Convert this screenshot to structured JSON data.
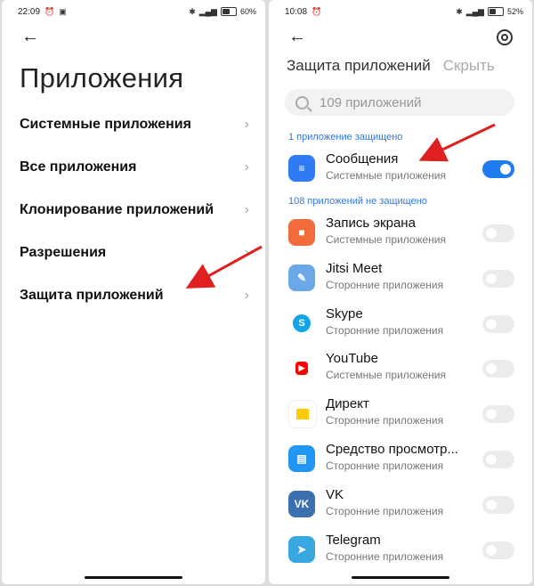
{
  "left_screen": {
    "status": {
      "time": "22:09",
      "battery": "60",
      "battery_level": 0.6
    },
    "title": "Приложения",
    "menu": [
      {
        "label": "Системные приложения"
      },
      {
        "label": "Все приложения"
      },
      {
        "label": "Клонирование приложений"
      },
      {
        "label": "Разрешения"
      },
      {
        "label": "Защита приложений"
      }
    ]
  },
  "right_screen": {
    "status": {
      "time": "10:08",
      "battery": "52",
      "battery_level": 0.52
    },
    "tabs": {
      "active": "Защита приложений",
      "inactive": "Скрыть"
    },
    "search": {
      "placeholder": "109 приложений"
    },
    "section_protected": "1 приложение защищено",
    "section_unprotected": "108 приложений не защищено",
    "protected_apps": [
      {
        "name": "Сообщения",
        "sub": "Системные приложения",
        "enabled": true,
        "icon": "messages-icon",
        "color": "#2f7bf3"
      }
    ],
    "apps": [
      {
        "name": "Запись экрана",
        "sub": "Системные приложения",
        "enabled": false,
        "icon": "screen-recorder-icon",
        "color": "#f26b3a"
      },
      {
        "name": "Jitsi Meet",
        "sub": "Сторонние приложения",
        "enabled": false,
        "icon": "jitsi-meet-icon",
        "color": "#6aa8e8"
      },
      {
        "name": "Skype",
        "sub": "Сторонние приложения",
        "enabled": false,
        "icon": "skype-icon",
        "color": "#12a3e8"
      },
      {
        "name": "YouTube",
        "sub": "Системные приложения",
        "enabled": false,
        "icon": "youtube-icon",
        "color": "#ff0000"
      },
      {
        "name": "Директ",
        "sub": "Сторонние приложения",
        "enabled": false,
        "icon": "direct-icon",
        "color": "#ffcc00"
      },
      {
        "name": "Средство просмотр...",
        "sub": "Сторонние приложения",
        "enabled": false,
        "icon": "document-viewer-icon",
        "color": "#2196f3"
      },
      {
        "name": "VK",
        "sub": "Сторонние приложения",
        "enabled": false,
        "icon": "vk-icon",
        "color": "#3a6fb0"
      },
      {
        "name": "Telegram",
        "sub": "Сторонние приложения",
        "enabled": false,
        "icon": "telegram-icon",
        "color": "#38a8e0"
      }
    ]
  },
  "annotation_arrow_color": "#e02020"
}
